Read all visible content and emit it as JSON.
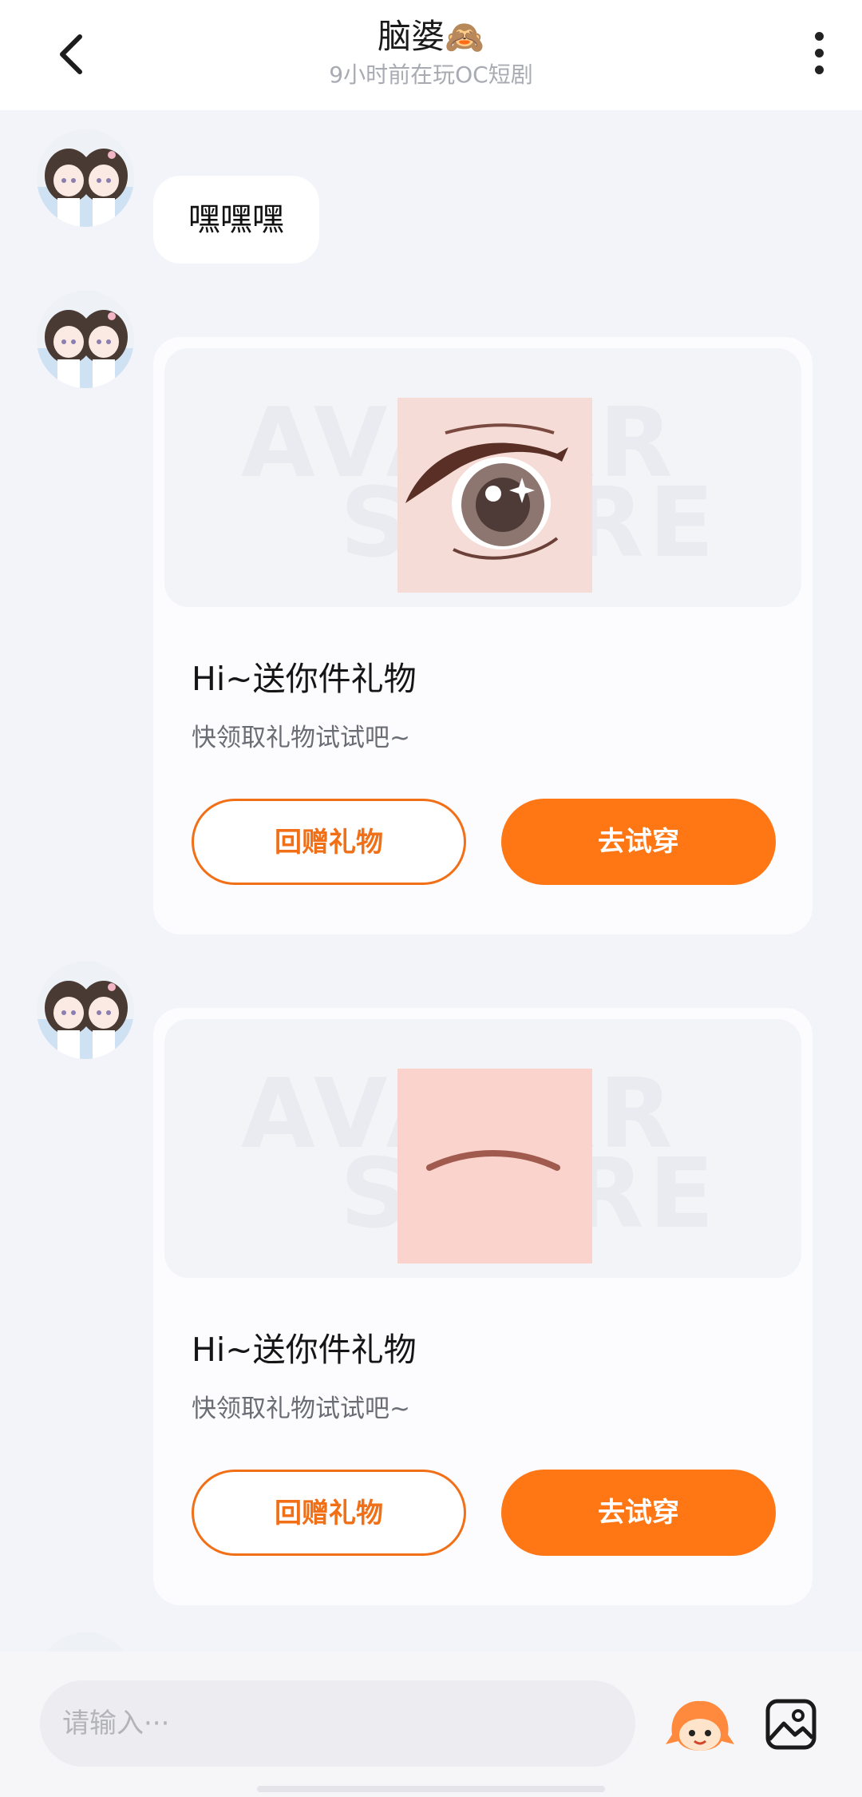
{
  "header": {
    "title": "脑婆",
    "title_emoji": "🙈",
    "subtitle": "9小时前在玩OC短剧",
    "back_icon": "chevron-left-icon",
    "more_icon": "more-vertical-icon"
  },
  "messages": {
    "text_message": "嘿嘿嘿",
    "gift_cards": [
      {
        "title": "Hi~送你件礼物",
        "description": "快领取礼物试试吧~",
        "return_gift_label": "回赠礼物",
        "try_on_label": "去试穿",
        "item": "anime-eye-icon"
      },
      {
        "title": "Hi~送你件礼物",
        "description": "快领取礼物试试吧~",
        "return_gift_label": "回赠礼物",
        "try_on_label": "去试穿",
        "item": "closed-eye-icon"
      }
    ],
    "watermark": "AVATAR STORE"
  },
  "input_bar": {
    "placeholder": "请输入···",
    "mascot_icon": "mascot-icon",
    "image_icon": "image-icon"
  },
  "colors": {
    "accent": "#ff7614",
    "background": "#f3f4f9"
  }
}
